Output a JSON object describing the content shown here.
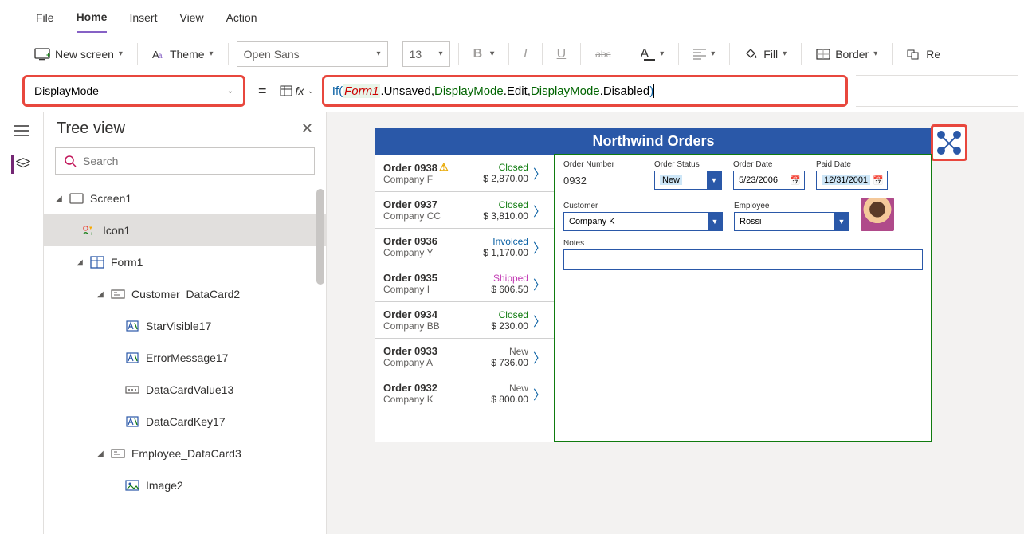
{
  "menubar": {
    "file": "File",
    "home": "Home",
    "insert": "Insert",
    "view": "View",
    "action": "Action"
  },
  "toolbar": {
    "newscreen": "New screen",
    "theme": "Theme",
    "font": "Open Sans",
    "size": "13",
    "fill": "Fill",
    "border": "Border",
    "reorder": "Re"
  },
  "formula": {
    "property": "DisplayMode",
    "tokens": {
      "if": "If(",
      "sp1": " ",
      "ref": "Form1",
      "p1": ".Unsaved, ",
      "dm1": "DisplayMode",
      "p2": ".Edit, ",
      "dm2": "DisplayMode",
      "p3": ".Disabled ",
      "close": ")"
    }
  },
  "tree": {
    "title": "Tree view",
    "search_placeholder": "Search",
    "items": {
      "screen1": "Screen1",
      "icon1": "Icon1",
      "form1": "Form1",
      "customer_dc": "Customer_DataCard2",
      "starvisible": "StarVisible17",
      "errormsg": "ErrorMessage17",
      "dcvalue": "DataCardValue13",
      "dckey": "DataCardKey17",
      "employee_dc": "Employee_DataCard3",
      "image2": "Image2"
    }
  },
  "preview": {
    "title": "Northwind Orders",
    "orders": [
      {
        "id": "Order 0938",
        "company": "Company F",
        "status": "Closed",
        "status_class": "closed",
        "amount": "$ 2,870.00",
        "warn": true
      },
      {
        "id": "Order 0937",
        "company": "Company CC",
        "status": "Closed",
        "status_class": "closed",
        "amount": "$ 3,810.00"
      },
      {
        "id": "Order 0936",
        "company": "Company Y",
        "status": "Invoiced",
        "status_class": "invoiced",
        "amount": "$ 1,170.00"
      },
      {
        "id": "Order 0935",
        "company": "Company I",
        "status": "Shipped",
        "status_class": "shipped",
        "amount": "$ 606.50"
      },
      {
        "id": "Order 0934",
        "company": "Company BB",
        "status": "Closed",
        "status_class": "closed",
        "amount": "$ 230.00"
      },
      {
        "id": "Order 0933",
        "company": "Company A",
        "status": "New",
        "status_class": "new",
        "amount": "$ 736.00"
      },
      {
        "id": "Order 0932",
        "company": "Company K",
        "status": "New",
        "status_class": "new",
        "amount": "$ 800.00"
      }
    ],
    "form": {
      "order_number_label": "Order Number",
      "order_number": "0932",
      "order_status_label": "Order Status",
      "order_status": "New",
      "order_date_label": "Order Date",
      "order_date": "5/23/2006",
      "paid_date_label": "Paid Date",
      "paid_date": "12/31/2001",
      "customer_label": "Customer",
      "customer": "Company K",
      "employee_label": "Employee",
      "employee": "Rossi",
      "notes_label": "Notes",
      "notes": ""
    }
  }
}
